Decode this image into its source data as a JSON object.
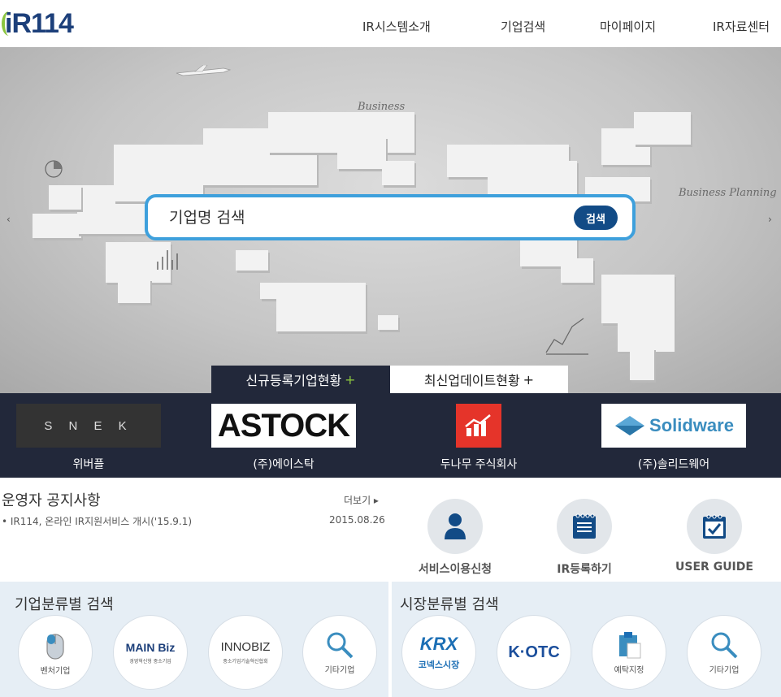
{
  "header": {
    "logo_text": "iR114",
    "nav": [
      "IR시스템소개",
      "기업검색",
      "마이페이지",
      "IR자료센터"
    ]
  },
  "hero": {
    "search_placeholder": "기업명 검색",
    "search_button": "검색",
    "prev_arrow": "‹",
    "next_arrow": "›",
    "sketch_texts": [
      "Business",
      "Business Planning"
    ]
  },
  "tabs": [
    {
      "label": "신규등록기업현황",
      "plus": "+",
      "active": true
    },
    {
      "label": "최신업데이트현황",
      "plus": "+",
      "active": false
    }
  ],
  "companies": [
    {
      "logo_text": "S N E K",
      "name": "위버플"
    },
    {
      "logo_text": "ASTOCK",
      "name": "(주)에이스탁"
    },
    {
      "logo_text": "",
      "name": "두나무 주식회사"
    },
    {
      "logo_text": "Solidware",
      "name": "(주)솔리드웨어"
    }
  ],
  "notice": {
    "title": "운영자 공지사항",
    "more": "더보기 ▸",
    "items": [
      {
        "text": "• IR114, 온라인 IR지원서비스 개시('15.9.1)",
        "date": "2015.08.26"
      }
    ]
  },
  "services": [
    {
      "label": "서비스이용신청",
      "icon": "user-icon"
    },
    {
      "label": "IR등록하기",
      "icon": "notepad-icon"
    },
    {
      "label": "USER GUIDE",
      "icon": "calendar-check-icon"
    }
  ],
  "category_search": {
    "title": "기업분류별 검색",
    "items": [
      {
        "label": "벤처기업",
        "logo": ""
      },
      {
        "label": "",
        "logo": "MAIN Biz",
        "sub": "경영혁신형 중소기업"
      },
      {
        "label": "",
        "logo": "INNOBIZ",
        "sub": "중소기업기술혁신협회"
      },
      {
        "label": "기타기업",
        "logo": ""
      }
    ]
  },
  "market_search": {
    "title": "시장분류별 검색",
    "items": [
      {
        "label": "코넥스시장",
        "logo": "KRX"
      },
      {
        "label": "",
        "logo": "K·OTC"
      },
      {
        "label": "예탁지정",
        "logo": ""
      },
      {
        "label": "기타기업",
        "logo": ""
      }
    ]
  },
  "colors": {
    "brand_navy": "#1c3f7a",
    "brand_green": "#8bc53f",
    "strip_bg": "#22283a",
    "search_border": "#3ea0dc",
    "search_btn": "#124b86",
    "panel_bg": "#e6eef5"
  }
}
